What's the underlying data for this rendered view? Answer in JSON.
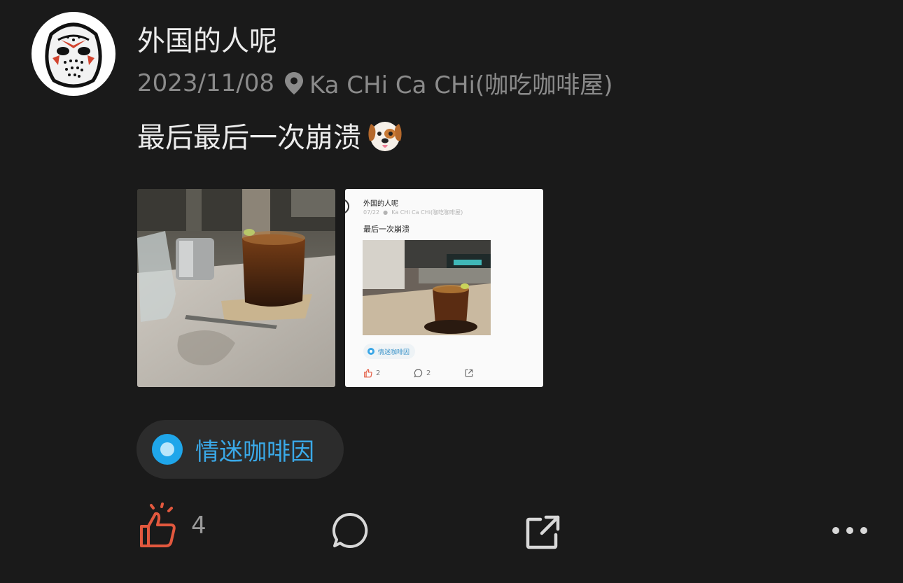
{
  "post": {
    "username": "外国的人呢",
    "date": "2023/11/08",
    "location": "Ka CHi Ca CHi(咖吃咖啡屋)",
    "text": "最后最后一次崩溃",
    "emoji": "dog-face",
    "topic_tag": "情迷咖啡因",
    "like_count": "4"
  },
  "embedded_post": {
    "username": "外国的人呢",
    "date": "07/22",
    "location": "Ka CHi Ca CHi(咖吃咖啡屋)",
    "text": "最后一次崩溃",
    "topic_tag": "情迷咖啡因",
    "like_count": "2",
    "comment_count": "2"
  },
  "colors": {
    "background": "#1a1a1a",
    "accent_blue": "#1fa6ea",
    "like_red": "#e2583e",
    "muted_text": "#8b8b8b"
  },
  "icons": [
    "mask-avatar",
    "location-pin-icon",
    "dog-emoji",
    "thumbs-up-icon",
    "comment-icon",
    "share-icon",
    "more-icon"
  ]
}
